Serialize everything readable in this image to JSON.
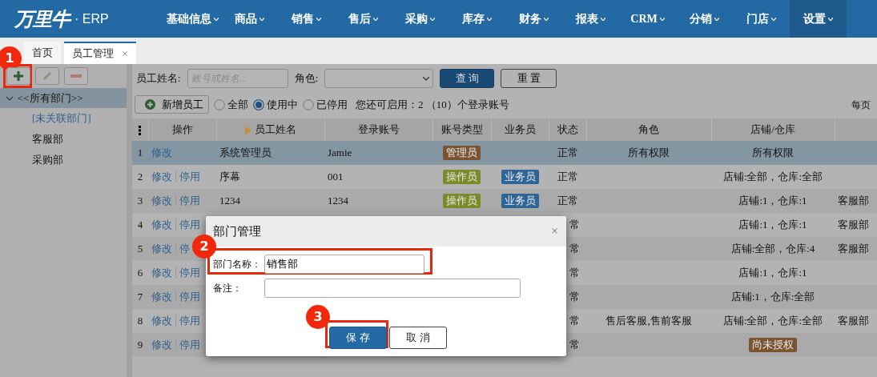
{
  "navbar": {
    "logo": "万里牛",
    "product": "· ERP",
    "menu": [
      {
        "label": "基础信息",
        "selected": false
      },
      {
        "label": "商品",
        "selected": false
      },
      {
        "label": "销售",
        "selected": false
      },
      {
        "label": "售后",
        "selected": false
      },
      {
        "label": "采购",
        "selected": false
      },
      {
        "label": "库存",
        "selected": false
      },
      {
        "label": "财务",
        "selected": false
      },
      {
        "label": "报表",
        "selected": false
      },
      {
        "label": "CRM",
        "selected": false
      },
      {
        "label": "分销",
        "selected": false
      },
      {
        "label": "门店",
        "selected": false
      },
      {
        "label": "设置",
        "selected": true
      }
    ]
  },
  "tabs": [
    {
      "label": "首页",
      "selected": false
    },
    {
      "label": "员工管理",
      "selected": true,
      "close": "×"
    }
  ],
  "sidebar": {
    "root": {
      "label": "<<所有部门>>",
      "expanded": true,
      "selected": true,
      "children": [
        {
          "label": "[未关联部门]",
          "kind": "link"
        },
        {
          "label": "客服部",
          "kind": "plain"
        },
        {
          "label": "采购部",
          "kind": "plain"
        }
      ]
    }
  },
  "search": {
    "name_label": "员工姓名:",
    "name_placeholder": "账号或姓名...",
    "role_label": "角色:",
    "query_button": "查 询",
    "reset_button": "重 置"
  },
  "toolbar": {
    "add_label": "新增员工",
    "radios": [
      {
        "label": "全部",
        "selected": false
      },
      {
        "label": "使用中",
        "selected": true
      },
      {
        "label": "已停用",
        "selected": false
      }
    ],
    "quota": "您还可启用：2 （10）个登录账号",
    "per_page": "每页"
  },
  "table": {
    "columns": [
      {
        "label": "操作",
        "sorted": false
      },
      {
        "label": "员工姓名",
        "sorted": true
      },
      {
        "label": "登录账号",
        "sorted": false
      },
      {
        "label": "账号类型",
        "sorted": false
      },
      {
        "label": "业务员",
        "sorted": false
      },
      {
        "label": "状态",
        "sorted": false
      },
      {
        "label": "角色",
        "sorted": false
      },
      {
        "label": "店铺/仓库",
        "sorted": false
      }
    ],
    "rows": [
      {
        "index": "1",
        "kind": "full",
        "selected": true,
        "actions": [
          "修改"
        ],
        "name": "系统管理员",
        "account": "Jamie",
        "type": {
          "text": "管理员",
          "color": "#7a5430"
        },
        "status": "正常",
        "role": "所有权限",
        "store": "所有权限"
      },
      {
        "index": "2",
        "kind": "full",
        "selected": false,
        "actions": [
          "修改",
          "停用"
        ],
        "name": "序幕",
        "account": "001",
        "type": {
          "text": "操作员",
          "color": "#7d8a2a"
        },
        "salesman": {
          "text": "业务员",
          "color": "#2f6497"
        },
        "status": "正常",
        "store": "店铺:全部，仓库:全部"
      },
      {
        "index": "3",
        "kind": "full",
        "selected": false,
        "actions": [
          "修改",
          "停用"
        ],
        "name": "1234",
        "account": "1234",
        "type": {
          "text": "操作员",
          "color": "#7d8a2a"
        },
        "salesman": {
          "text": "业务员",
          "color": "#2f6497"
        },
        "status": "正常",
        "store": "店铺:1，仓库:1",
        "dept": "客服部"
      },
      {
        "index": "4",
        "kind": "covered",
        "selected": false,
        "actions": [
          "修改",
          "停用"
        ],
        "status": "常",
        "store": "店铺:1，仓库:1",
        "dept": "客服部"
      },
      {
        "index": "5",
        "kind": "covered",
        "selected": false,
        "actions": [
          "修改",
          "停"
        ],
        "status": "常",
        "store": "店铺:全部，仓库:4",
        "dept": "客服部"
      },
      {
        "index": "6",
        "kind": "covered",
        "selected": false,
        "actions": [
          "修改",
          "停用"
        ],
        "status": "常",
        "store": "店铺:1，仓库:1"
      },
      {
        "index": "7",
        "kind": "covered",
        "selected": false,
        "actions": [
          "修改",
          "停用"
        ],
        "status": "常",
        "store": "店铺:1，仓库:全部"
      },
      {
        "index": "8",
        "kind": "covered",
        "selected": false,
        "actions": [
          "修改",
          "停用"
        ],
        "status": "常",
        "role": "售后客服,售前客服",
        "store": "店铺:全部，仓库:全部",
        "dept": "客服部"
      },
      {
        "index": "9",
        "kind": "covered",
        "selected": false,
        "actions": [
          "修改",
          "停用"
        ],
        "status": "常",
        "store": {
          "text": "尚未授权",
          "color": "#7a5430"
        }
      }
    ]
  },
  "dialog": {
    "title": "部门管理",
    "close": "×",
    "fields": [
      {
        "label": "部门名称：",
        "value": "销售部"
      },
      {
        "label": "备注："
      }
    ],
    "buttons": [
      {
        "label": "保 存",
        "kind": "primary"
      },
      {
        "label": "取 消",
        "kind": "secondary"
      }
    ]
  },
  "annotations": [
    {
      "label": "1"
    },
    {
      "label": "2"
    },
    {
      "label": "3"
    }
  ]
}
